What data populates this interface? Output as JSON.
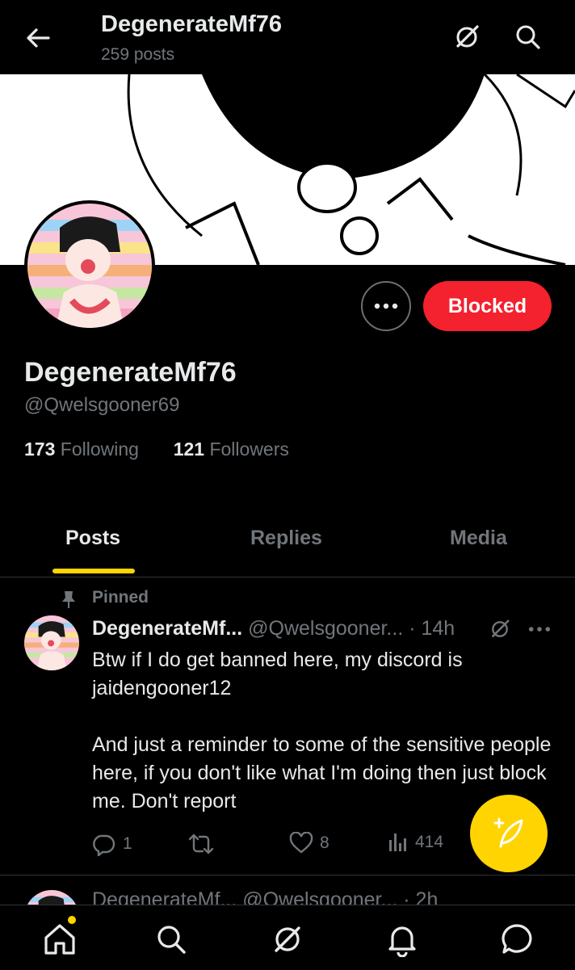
{
  "header": {
    "title": "DegenerateMf76",
    "subtitle": "259 posts"
  },
  "profile": {
    "display_name": "DegenerateMf76",
    "handle": "@Qwelsgooner69",
    "following_count": "173",
    "following_label": "Following",
    "followers_count": "121",
    "followers_label": "Followers",
    "blocked_label": "Blocked"
  },
  "tabs": [
    {
      "label": "Posts",
      "active": true
    },
    {
      "label": "Replies",
      "active": false
    },
    {
      "label": "Media",
      "active": false
    }
  ],
  "pinned_post": {
    "pinned_label": "Pinned",
    "author_name": "DegenerateMf...",
    "author_handle": "@Qwelsgooner...",
    "time": "· 14h",
    "body": [
      "Btw if I do get banned here, my discord is jaidengooner12",
      "And just a reminder to some of the sensitive people here, if you don't like what I'm doing then just block me. Don't report"
    ],
    "reply_count": "1",
    "like_count": "8",
    "view_count": "414"
  },
  "next_post_peek": {
    "text": "DegenerateMf...  @Qwelsgooner...  · 2h"
  },
  "colors": {
    "accent": "#ffd400",
    "blocked": "#f4212e",
    "muted": "#71767b",
    "text": "#e7e9ea"
  },
  "icons": [
    "back-arrow-icon",
    "grok-icon",
    "search-icon",
    "more-icon",
    "pin-icon",
    "reply-icon",
    "repost-icon",
    "like-icon",
    "views-icon",
    "compose-icon",
    "home-icon",
    "bell-icon",
    "messages-icon"
  ]
}
